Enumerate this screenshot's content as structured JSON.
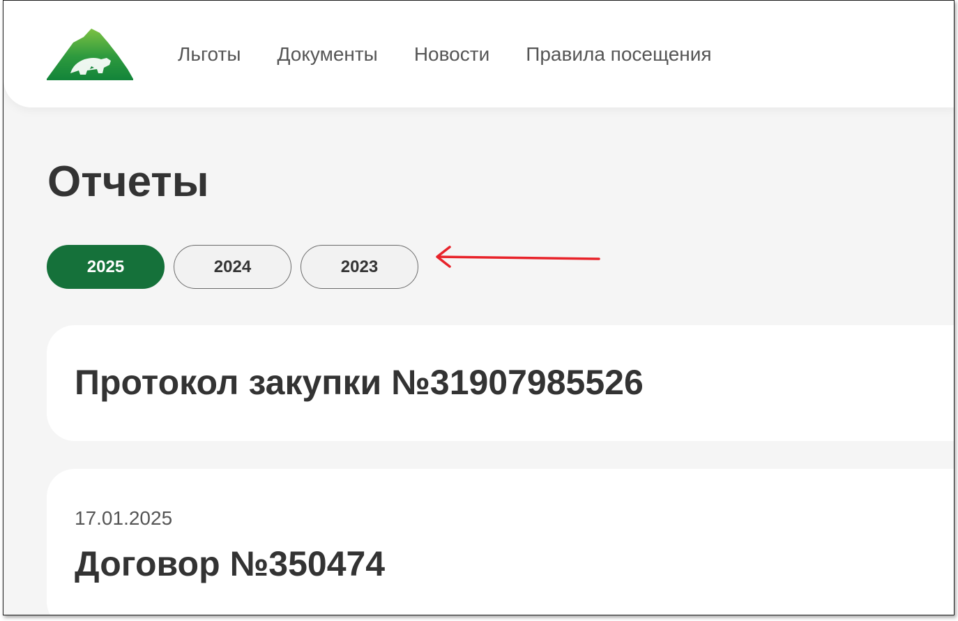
{
  "header": {
    "logo_icon": "mountain-bear-logo",
    "nav": [
      {
        "label": "Льготы"
      },
      {
        "label": "Документы"
      },
      {
        "label": "Новости"
      },
      {
        "label": "Правила посещения"
      }
    ]
  },
  "page": {
    "title": "Отчеты"
  },
  "year_tabs": [
    {
      "label": "2025",
      "active": true
    },
    {
      "label": "2024",
      "active": false
    },
    {
      "label": "2023",
      "active": false
    }
  ],
  "annotation": {
    "icon": "red-arrow-left-icon",
    "color": "#e8232a"
  },
  "reports": [
    {
      "date": "",
      "title": "Протокол закупки №31907985526"
    },
    {
      "date": "17.01.2025",
      "title": "Договор №350474"
    }
  ],
  "colors": {
    "accent": "#15713a",
    "background": "#f5f5f5",
    "card": "#ffffff",
    "text": "#333333"
  }
}
